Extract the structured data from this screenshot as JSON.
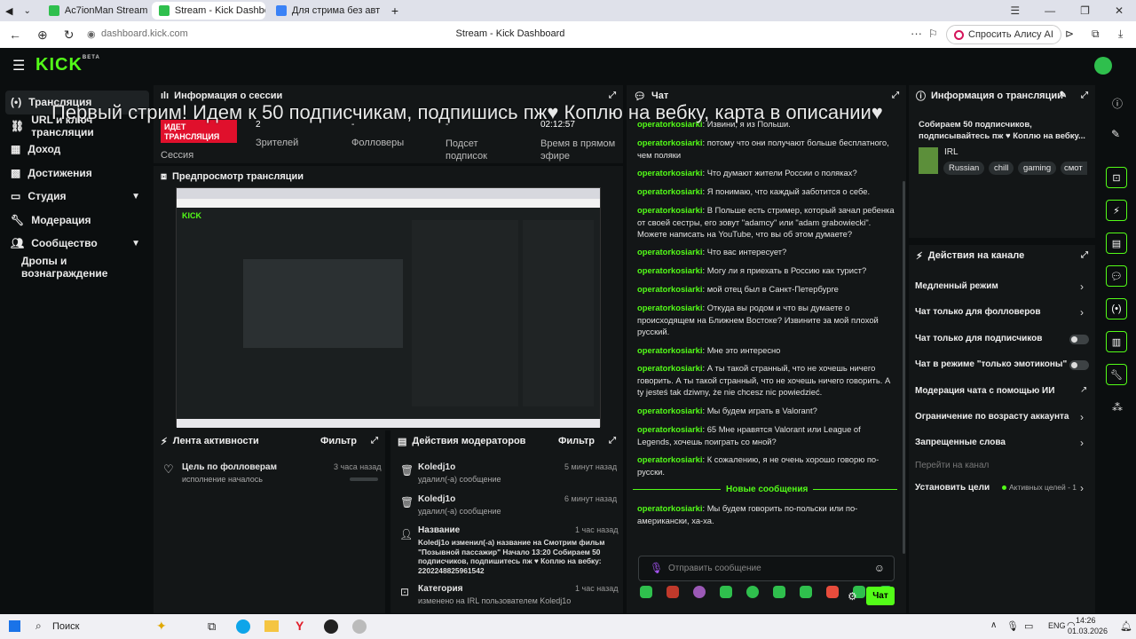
{
  "browser": {
    "tabs": [
      {
        "label": "Ac7ionMan Stream - Watc",
        "color": "#2fbf4d"
      },
      {
        "label": "Stream - Kick Dashboar",
        "color": "#2fbf4d"
      },
      {
        "label": "Для стрима без авт",
        "color": "#3b82f6"
      }
    ],
    "url": "dashboard.kick.com",
    "page_title": "Stream - Kick Dashboard",
    "alice_label": "Спросить Алису AI"
  },
  "app": {
    "logo": "KICK",
    "logo_badge": "BETA",
    "accent": "#53fc18",
    "overlay_title": "Первый стрим! Идем к 50 подписчикам, подпишись пж♥ Коплю на вебку, карта в описании♥"
  },
  "sidebar": {
    "items": [
      {
        "label": "Трансляция",
        "icon": "broadcast-icon"
      },
      {
        "label": "URL и ключ трансляции",
        "icon": "link-icon"
      },
      {
        "label": "Доход",
        "icon": "money-icon"
      },
      {
        "label": "Достижения",
        "icon": "trophy-icon"
      },
      {
        "label": "Студия",
        "icon": "studio-icon"
      },
      {
        "label": "Модерация",
        "icon": "wrench-icon"
      },
      {
        "label": "Сообщество",
        "icon": "people-icon"
      },
      {
        "label": "Дропы и вознаграждение",
        "icon": ""
      }
    ]
  },
  "session": {
    "title": "Информация о сессии",
    "live_badge": "ИДЕТ ТРАНСЛЯЦИЯ",
    "session_label": "Сессия",
    "viewers_value": "2",
    "viewers_label": "Зрителей",
    "followers_value": "-",
    "followers_label": "Фолловеры",
    "subs_value": "-",
    "subs_label": "Подсет подписок",
    "time_value": "02:12:57",
    "time_label": "Время в прямом эфире"
  },
  "preview": {
    "title": "Предпросмотр трансляции"
  },
  "activity": {
    "title": "Лента активности",
    "filter": "Фильтр",
    "item_title": "Цель по фолловерам",
    "item_sub": "исполнение началось",
    "item_time": "3 часа назад"
  },
  "modactions": {
    "title": "Действия модераторов",
    "filter": "Фильтр",
    "items": [
      {
        "user": "Koledj1o",
        "text": "удалил(-а) сообщение",
        "time": "5 минут назад"
      },
      {
        "user": "Koledj1o",
        "text": "удалил(-а) сообщение",
        "time": "6 минут назад"
      },
      {
        "user": "Название",
        "text": "Koledj1o изменил(-а) название на Смотрим фильм \"Позывной пассажир\" Начало 13:20 Собираем 50 подписчиков, подпишитесь пж ♥ Коплю на вебку: 2202248825961542",
        "time": "1 час назад"
      },
      {
        "user": "Категория",
        "text": "изменено на IRL пользователем Koledj1o",
        "time": "1 час назад"
      }
    ]
  },
  "chat": {
    "title": "Чат",
    "messages": [
      {
        "user": "operatorkosiarki",
        "text": "Извини, я из Польши."
      },
      {
        "user": "operatorkosiarki",
        "text": "потому что они получают больше бесплатного, чем поляки"
      },
      {
        "user": "operatorkosiarki",
        "text": "Что думают жители России о поляках?"
      },
      {
        "user": "operatorkosiarki",
        "text": "Я понимаю, что каждый заботится о себе."
      },
      {
        "user": "operatorkosiarki",
        "text": "В Польше есть стример, который зачал ребенка от своей сестры, его зовут \"adamcy\" или \"adam grabowiecki\". Можете написать на YouTube, что вы об этом думаете?"
      },
      {
        "user": "operatorkosiarki",
        "text": "Что вас интересует?"
      },
      {
        "user": "operatorkosiarki",
        "text": "Могу ли я приехать в Россию как турист?"
      },
      {
        "user": "operatorkosiarki",
        "text": "мой отец был в Санкт-Петербурге"
      },
      {
        "user": "operatorkosiarki",
        "text": "Откуда вы родом и что вы думаете о происходящем на Ближнем Востоке? Извините за мой плохой русский."
      },
      {
        "user": "operatorkosiarki",
        "text": "Мне это интересно"
      },
      {
        "user": "operatorkosiarki",
        "text": "А ты такой странный, что не хочешь ничего говорить. А ты такой странный, что не хочешь ничего говорить. A ty jesteś tak dziwny, że nie chcesz nic powiedzieć."
      },
      {
        "user": "operatorkosiarki",
        "text": "Мы будем играть в Valorant?"
      },
      {
        "user": "operatorkosiarki",
        "text": "65 Мне нравятся Valorant или League of Legends, хочешь поиграть со мной?"
      },
      {
        "user": "operatorkosiarki",
        "text": "К сожалению, я не очень хорошо говорю по-русски."
      },
      {
        "user": "operatorkosiarki",
        "text": "Мы будем говорить по-польски или по-американски, ха-ха."
      }
    ],
    "new_messages": "Новые сообщения",
    "input_placeholder": "Отправить сообщение",
    "send_label": "Чат"
  },
  "streaminfo": {
    "title": "Информация о трансляции",
    "text": "Собираем 50 подписчиков, подписывайтесь пж ♥ Коплю на вебку...",
    "category": "IRL",
    "tags": [
      "Russian",
      "chill",
      "gaming",
      "смот"
    ]
  },
  "channel": {
    "title": "Действия на канале",
    "rows": [
      {
        "label": "Медленный режим",
        "kind": "chevron"
      },
      {
        "label": "Чат только для фолловеров",
        "kind": "chevron"
      },
      {
        "label": "Чат только для подписчиков",
        "kind": "toggle"
      },
      {
        "label": "Чат в режиме \"только эмотиконы\"",
        "kind": "toggle"
      },
      {
        "label": "Модерация чата с помощью ИИ",
        "kind": "external"
      },
      {
        "label": "Ограничение по возрасту аккаунта",
        "kind": "chevron"
      },
      {
        "label": "Запрещенные слова",
        "kind": "chevron"
      }
    ],
    "goto": "Перейти на канал",
    "goals_label": "Установить цели",
    "goals_status": "Активных целей - 1"
  },
  "taskbar": {
    "search": "Поиск",
    "lang": "ENG",
    "time": "14:26",
    "date": "01.03.2026"
  }
}
